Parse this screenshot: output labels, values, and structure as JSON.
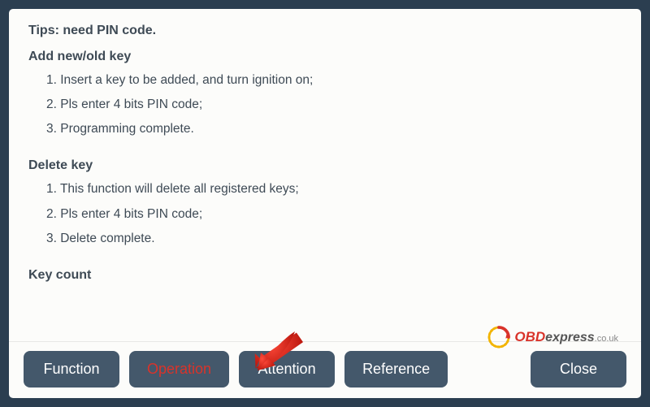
{
  "tips": "Tips: need PIN code.",
  "sections": {
    "add": {
      "title": "Add new/old key",
      "steps": [
        "1. Insert a key to be added, and turn ignition on;",
        "2. Pls enter 4 bits PIN code;",
        "3. Programming complete."
      ]
    },
    "delete": {
      "title": "Delete key",
      "steps": [
        "1. This function will delete all registered keys;",
        "2. Pls enter 4 bits PIN code;",
        "3. Delete complete."
      ]
    },
    "keycount": {
      "title": "Key count"
    }
  },
  "buttons": {
    "function": "Function",
    "operation": "Operation",
    "attention": "Attention",
    "reference": "Reference",
    "close": "Close"
  },
  "watermark": {
    "part1": "OBD",
    "part2": "express",
    "part3": ".co.uk"
  },
  "colors": {
    "accent_red": "#d9332a",
    "button_bg": "#44586b",
    "frame": "#2b3e50"
  }
}
